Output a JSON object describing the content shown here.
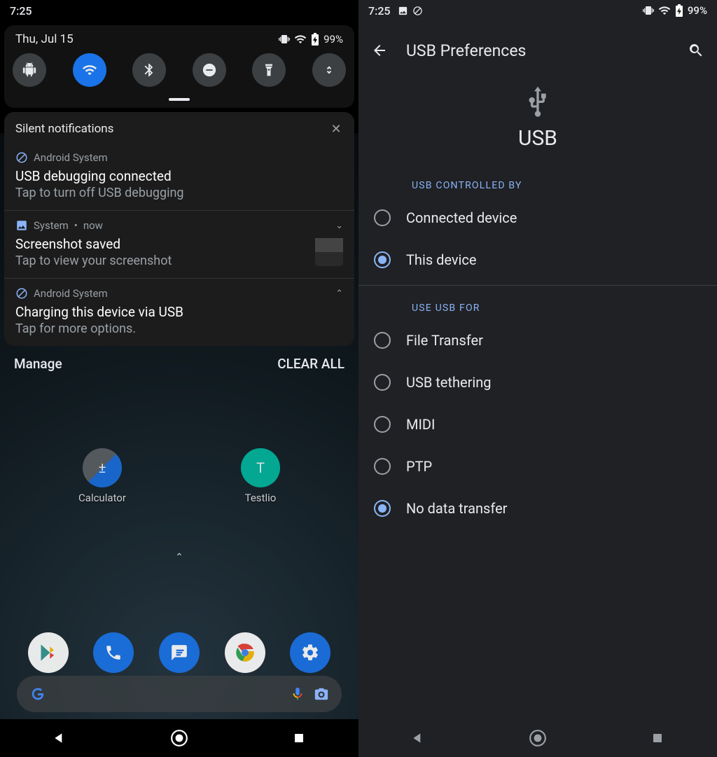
{
  "left": {
    "clock": "7:25",
    "date": "Thu, Jul 15",
    "battery": "99%",
    "qs_tiles": [
      {
        "name": "android-head",
        "active": false
      },
      {
        "name": "wifi",
        "active": true
      },
      {
        "name": "bluetooth",
        "active": false
      },
      {
        "name": "dnd",
        "active": false
      },
      {
        "name": "flashlight",
        "active": false
      },
      {
        "name": "auto-rotate",
        "active": false
      }
    ],
    "silent_header": "Silent notifications",
    "notifs": [
      {
        "app": "Android System",
        "title": "USB debugging connected",
        "body": "Tap to turn off USB debugging",
        "icon": "nosign",
        "chevron": ""
      },
      {
        "app": "System",
        "when": "now",
        "title": "Screenshot saved",
        "body": "Tap to view your screenshot",
        "icon": "image",
        "chevron": "down",
        "thumb": true
      },
      {
        "app": "Android System",
        "title": "Charging this device via USB",
        "body": "Tap for more options.",
        "icon": "nosign",
        "chevron": "up"
      }
    ],
    "manage": "Manage",
    "clear_all": "CLEAR ALL",
    "home_apps": [
      {
        "label": "Calculator"
      },
      {
        "label": "Testlio"
      }
    ]
  },
  "right": {
    "clock": "7:25",
    "battery": "99%",
    "appbar_title": "USB Preferences",
    "hero_label": "USB",
    "section_controlled": "USB CONTROLLED BY",
    "controlled_options": [
      {
        "label": "Connected device",
        "checked": false
      },
      {
        "label": "This device",
        "checked": true
      }
    ],
    "section_use": "USE USB FOR",
    "use_options": [
      {
        "label": "File Transfer",
        "checked": false
      },
      {
        "label": "USB tethering",
        "checked": false
      },
      {
        "label": "MIDI",
        "checked": false
      },
      {
        "label": "PTP",
        "checked": false
      },
      {
        "label": "No data transfer",
        "checked": true
      }
    ]
  }
}
